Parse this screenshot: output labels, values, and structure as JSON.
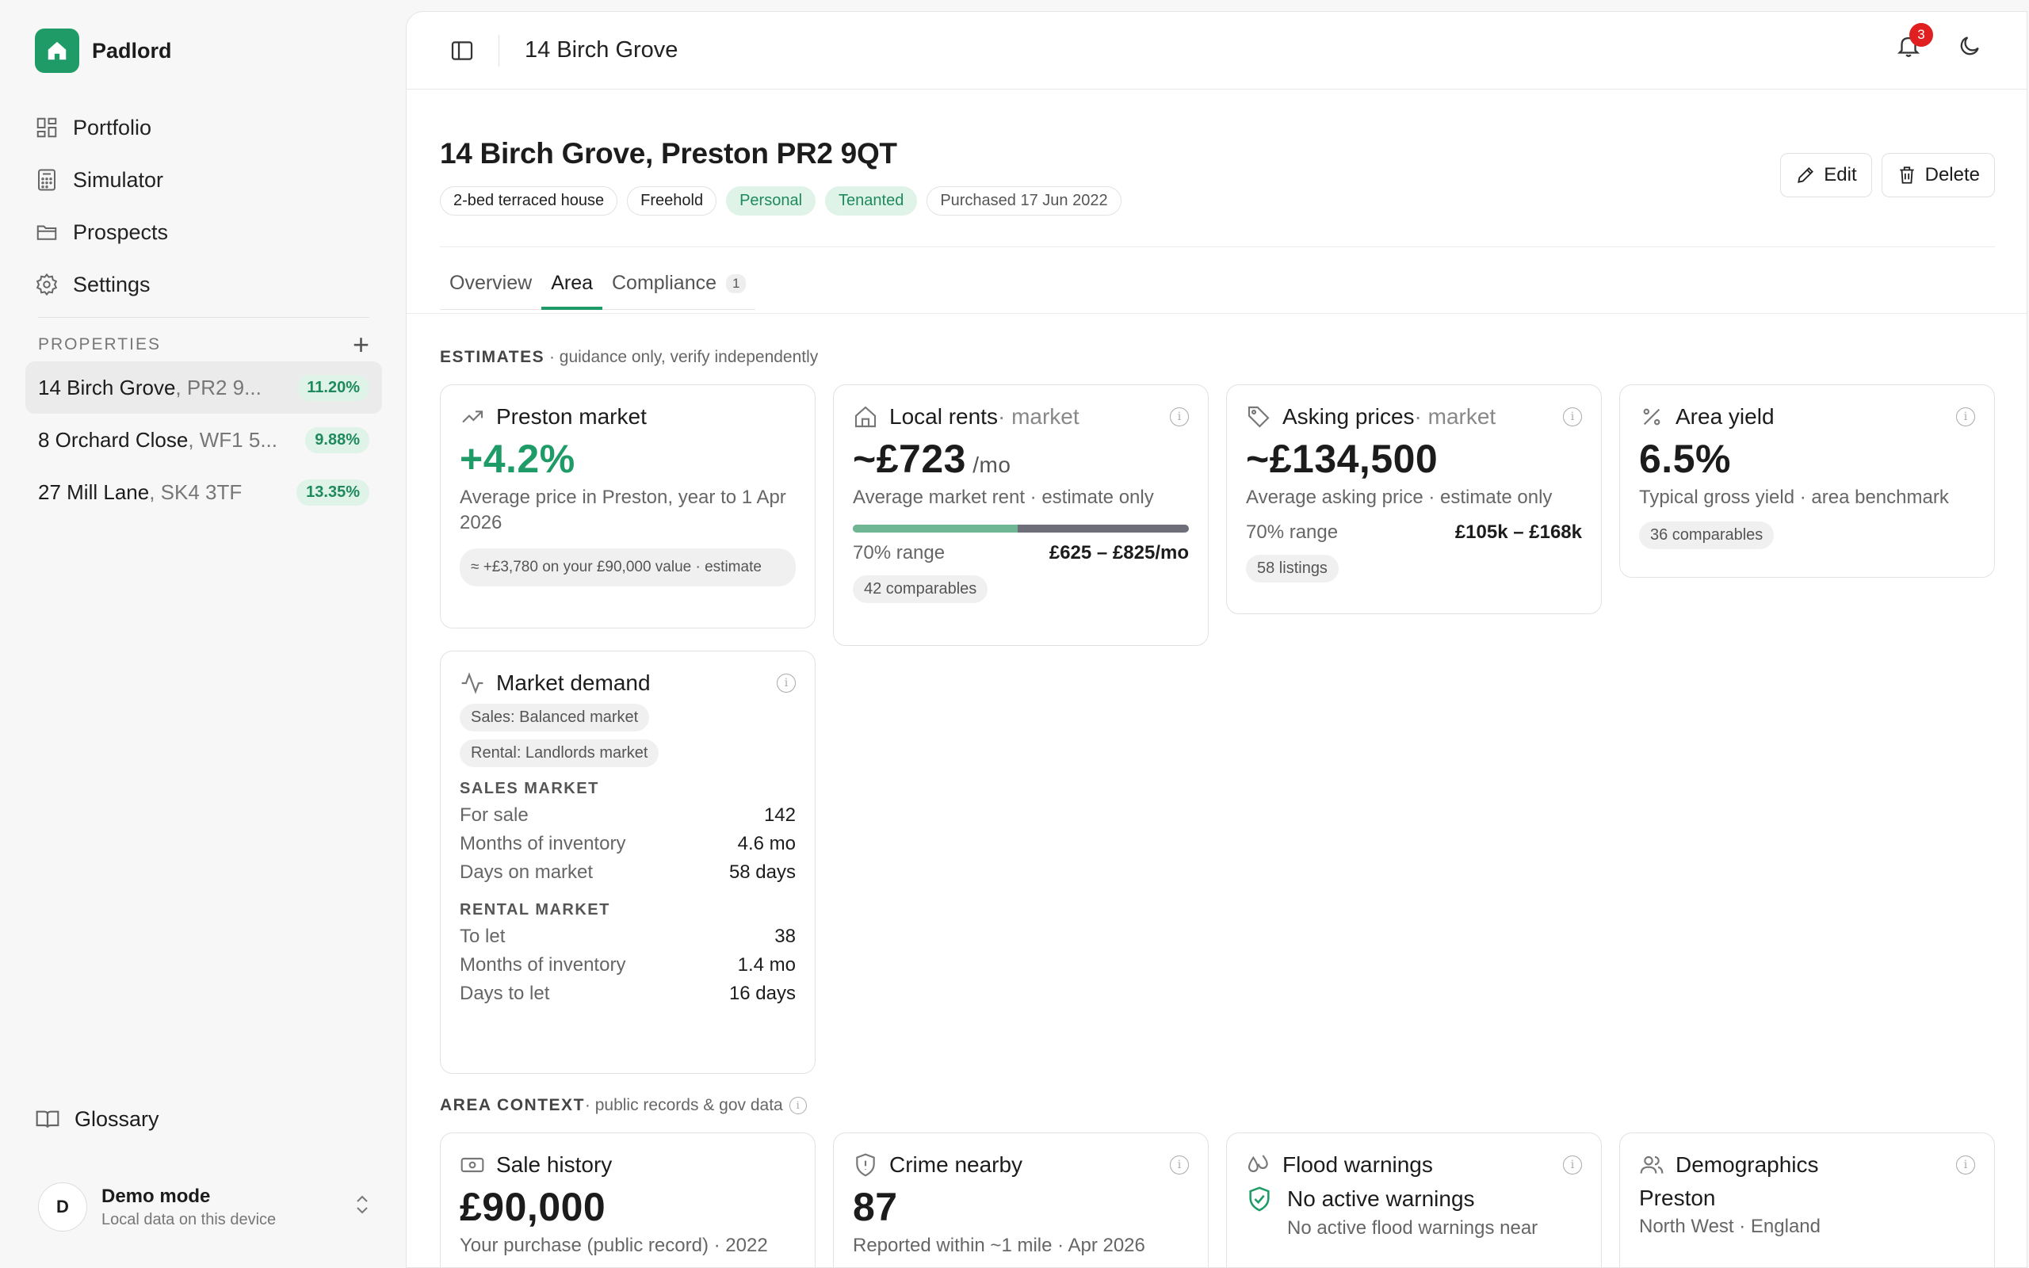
{
  "brand": {
    "name": "Padlord",
    "accent": "#1e9b67"
  },
  "nav": [
    {
      "label": "Portfolio",
      "icon": "grid-icon"
    },
    {
      "label": "Simulator",
      "icon": "calculator-icon"
    },
    {
      "label": "Prospects",
      "icon": "folder-icon"
    },
    {
      "label": "Settings",
      "icon": "gear-icon"
    }
  ],
  "properties": {
    "heading": "Properties",
    "add": "+",
    "items": [
      {
        "name": "14 Birch Grove",
        "postcode": ", PR2 9...",
        "yield": "11.20%",
        "active": true
      },
      {
        "name": "8 Orchard Close",
        "postcode": ", WF1 5...",
        "yield": "9.88%"
      },
      {
        "name": "27 Mill Lane",
        "postcode": ", SK4 3TF",
        "yield": "13.35%"
      }
    ]
  },
  "glossary": "Glossary",
  "demo": {
    "initial": "D",
    "title": "Demo mode",
    "subtitle": "Local data on this device",
    "chevron": "⌃⌄"
  },
  "topbar": {
    "title": "14 Birch Grove",
    "notifications": "3"
  },
  "page": {
    "title": "14 Birch Grove, Preston PR2 9QT",
    "chips": [
      "2-bed terraced house",
      "Freehold",
      "Personal",
      "Tenanted",
      "Purchased 17 Jun 2022"
    ],
    "edit": "Edit",
    "delete": "Delete",
    "tabs": [
      {
        "label": "Overview"
      },
      {
        "label": "Area",
        "active": true
      },
      {
        "label": "Compliance",
        "count": "1"
      }
    ]
  },
  "estimates": {
    "label": "ESTIMATES",
    "sublabel": " · guidance only, verify independently",
    "market": {
      "title": "Preston market",
      "value": "+4.2%",
      "desc": "Average price in Preston, year to 1 Apr 2026",
      "note": "≈ +£3,780 on your £90,000 value · estimate"
    },
    "rents": {
      "title": "Local rents",
      "title_sub": " · market",
      "value": "~£723",
      "unit": " /mo",
      "desc": "Average market rent · estimate only",
      "range_label": "70% range",
      "range_value": "£625 – £825/mo",
      "range_fill": 0.49,
      "comparables": "42 comparables"
    },
    "asking": {
      "title": "Asking prices",
      "title_sub": " · market",
      "value": "~£134,500",
      "desc": "Average asking price · estimate only",
      "range_label": "70% range",
      "range_value": "£105k – £168k",
      "listings": "58 listings"
    },
    "yield": {
      "title": "Area yield",
      "value": "6.5%",
      "desc": "Typical gross yield · area benchmark",
      "comparables": "36 comparables"
    },
    "demand": {
      "title": "Market demand",
      "tags": [
        "Sales: Balanced market",
        "Rental: Landlords market"
      ],
      "sales_head": "SALES MARKET",
      "sales": [
        {
          "k": "For sale",
          "v": "142"
        },
        {
          "k": "Months of inventory",
          "v": "4.6 mo"
        },
        {
          "k": "Days on market",
          "v": "58 days"
        }
      ],
      "rental_head": "RENTAL MARKET",
      "rental": [
        {
          "k": "To let",
          "v": "38"
        },
        {
          "k": "Months of inventory",
          "v": "1.4 mo"
        },
        {
          "k": "Days to let",
          "v": "16 days"
        }
      ]
    }
  },
  "context": {
    "label": "AREA CONTEXT",
    "sublabel": " · public records & gov data",
    "sale": {
      "title": "Sale history",
      "value": "£90,000",
      "desc": "Your purchase (public record) · 2022"
    },
    "crime": {
      "title": "Crime nearby",
      "value": "87",
      "desc": "Reported within ~1 mile · Apr 2026"
    },
    "flood": {
      "title": "Flood warnings",
      "status": "No active warnings",
      "desc": "No active flood warnings near"
    },
    "demo": {
      "title": "Demographics",
      "place": "Preston",
      "region": "North West · England"
    }
  }
}
